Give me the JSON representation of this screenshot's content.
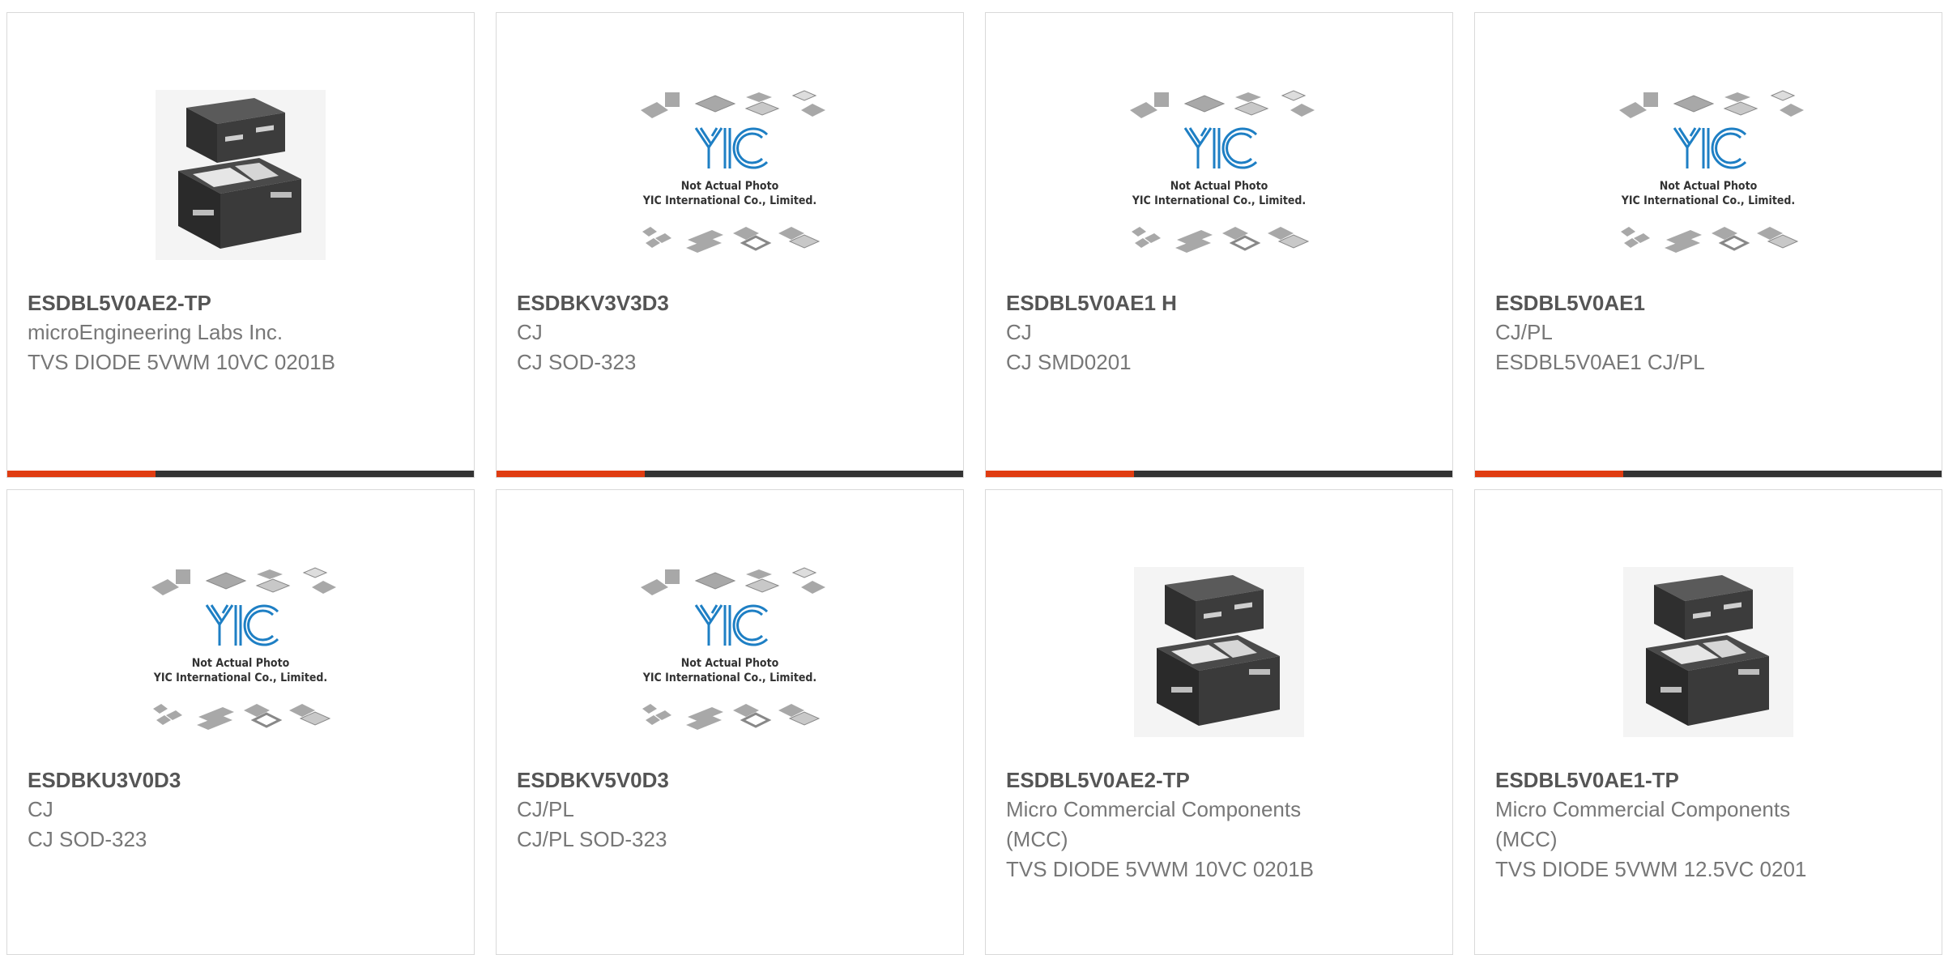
{
  "products": [
    {
      "part_number": "ESDBL5V0AE2-TP",
      "manufacturer": "microEngineering Labs Inc.",
      "description": "TVS DIODE 5VWM 10VC 0201B",
      "image": "chip-photo",
      "accent_bar": true
    },
    {
      "part_number": "ESDBKV3V3D3",
      "manufacturer": "CJ",
      "description": "CJ SOD-323",
      "image": "yic-placeholder",
      "accent_bar": true
    },
    {
      "part_number": "ESDBL5V0AE1 H",
      "manufacturer": "CJ",
      "description": "CJ SMD0201",
      "image": "yic-placeholder",
      "accent_bar": true
    },
    {
      "part_number": "ESDBL5V0AE1",
      "manufacturer": "CJ/PL",
      "description": "ESDBL5V0AE1 CJ/PL",
      "image": "yic-placeholder",
      "accent_bar": true
    },
    {
      "part_number": "ESDBKU3V0D3",
      "manufacturer": "CJ",
      "description": "CJ SOD-323",
      "image": "yic-placeholder",
      "accent_bar": false
    },
    {
      "part_number": "ESDBKV5V0D3",
      "manufacturer": "CJ/PL",
      "description": "CJ/PL SOD-323",
      "image": "yic-placeholder",
      "accent_bar": false
    },
    {
      "part_number": "ESDBL5V0AE2-TP",
      "manufacturer": "Micro Commercial Components (MCC)",
      "description": "TVS DIODE 5VWM 10VC 0201B",
      "image": "chip-photo",
      "accent_bar": false
    },
    {
      "part_number": "ESDBL5V0AE1-TP",
      "manufacturer": "Micro Commercial Components (MCC)",
      "description": "TVS DIODE 5VWM 12.5VC 0201",
      "image": "chip-photo",
      "accent_bar": false
    }
  ],
  "placeholder_text": {
    "line1": "Not Actual Photo",
    "line2": "YIC International Co., Limited.",
    "logo": "YIC"
  },
  "colors": {
    "accent": "#e03c11",
    "bar": "#333333",
    "border": "#d9d9d9",
    "logo_blue": "#1e7fc4"
  }
}
